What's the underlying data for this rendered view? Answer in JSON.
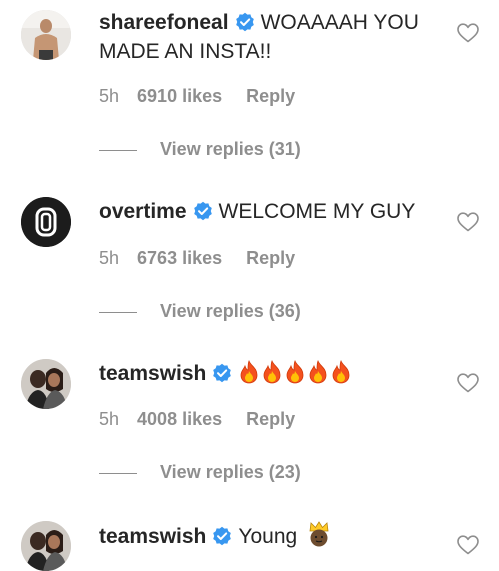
{
  "comments": [
    {
      "username": "shareefoneal",
      "text": "WOAAAAH YOU MADE AN INSTA!!",
      "time": "5h",
      "likes": "6910 likes",
      "reply": "Reply",
      "view_replies": "View replies (31)",
      "avatar": "person-shirtless-avatar"
    },
    {
      "username": "overtime",
      "text": "WELCOME MY GUY",
      "time": "5h",
      "likes": "6763 likes",
      "reply": "Reply",
      "view_replies": "View replies (36)",
      "avatar": "overtime-logo-avatar"
    },
    {
      "username": "teamswish",
      "text": "🔥🔥🔥🔥🔥",
      "time": "5h",
      "likes": "4008 likes",
      "reply": "Reply",
      "view_replies": "View replies (23)",
      "avatar": "couple-photo-avatar"
    },
    {
      "username": "teamswish",
      "text": "Young",
      "avatar": "couple-photo-avatar",
      "emoji": "crowned-face-emoji"
    }
  ],
  "colors": {
    "text": "#262626",
    "muted": "#8e8e8e",
    "verified": "#3897f0",
    "overtime_logo_bg": "#1c1c1c"
  },
  "icons": {
    "verified": "verified-badge-icon",
    "like": "heart-outline-icon",
    "fire": "fire-emoji"
  }
}
